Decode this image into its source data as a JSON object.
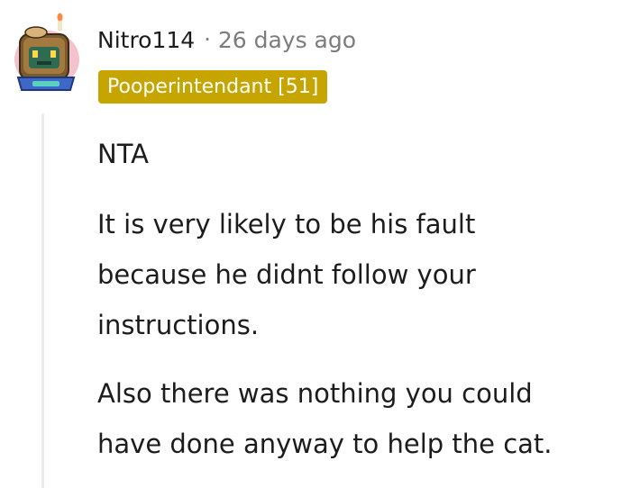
{
  "comment": {
    "username": "Nitro114",
    "separator": "·",
    "timestamp": "26 days ago",
    "flair": "Pooperintendant [51]",
    "paragraphs": [
      [
        "NTA"
      ],
      [
        "It is very likely to be his fault",
        "because he didnt follow your",
        "instructions."
      ],
      [
        "Also there was nothing you could",
        "have done anyway to help the cat."
      ]
    ]
  },
  "colors": {
    "flair_bg": "#c6a500",
    "flair_text": "#ffffff",
    "meta_gray": "#7c7c7c",
    "thread_line": "#e9ebed"
  },
  "icons": {
    "avatar": "snoo-avatar-icon"
  }
}
